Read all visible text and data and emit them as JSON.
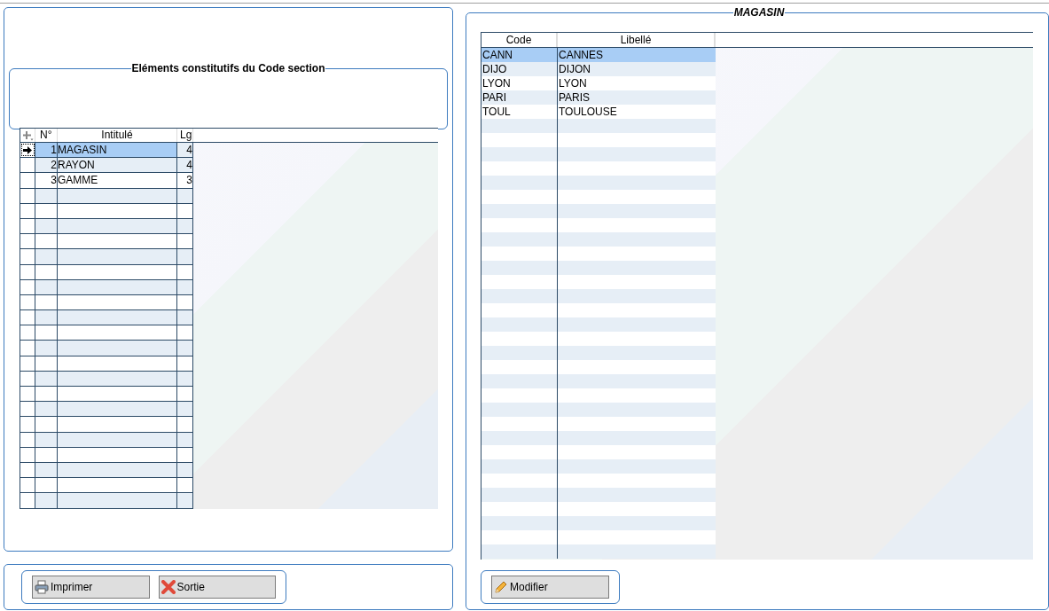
{
  "left_panel": {
    "group_title": "Eléments constitutifs du Code section",
    "table": {
      "columns": [
        "N°",
        "Intitulé",
        "Lg"
      ],
      "rows": [
        {
          "number": "1",
          "label": "MAGASIN",
          "length": "4",
          "selected": true
        },
        {
          "number": "2",
          "label": "RAYON",
          "length": "4",
          "selected": false
        },
        {
          "number": "3",
          "label": "GAMME",
          "length": "3",
          "selected": false
        }
      ]
    }
  },
  "left_buttons": [
    {
      "label": "Imprimer",
      "kind": "print"
    },
    {
      "label": "Sortie",
      "kind": "exit"
    }
  ],
  "right_panel": {
    "title": "MAGASIN",
    "table": {
      "columns": [
        "Code",
        "Libellé"
      ],
      "rows": [
        {
          "code": "CANN",
          "label": "CANNES",
          "selected": true
        },
        {
          "code": "DIJO",
          "label": "DIJON",
          "selected": false
        },
        {
          "code": "LYON",
          "label": "LYON",
          "selected": false
        },
        {
          "code": "PARI",
          "label": "PARIS",
          "selected": false
        },
        {
          "code": "TOUL",
          "label": "TOULOUSE",
          "selected": false
        }
      ]
    }
  },
  "right_buttons": [
    {
      "label": "Modifier",
      "kind": "edit"
    }
  ]
}
